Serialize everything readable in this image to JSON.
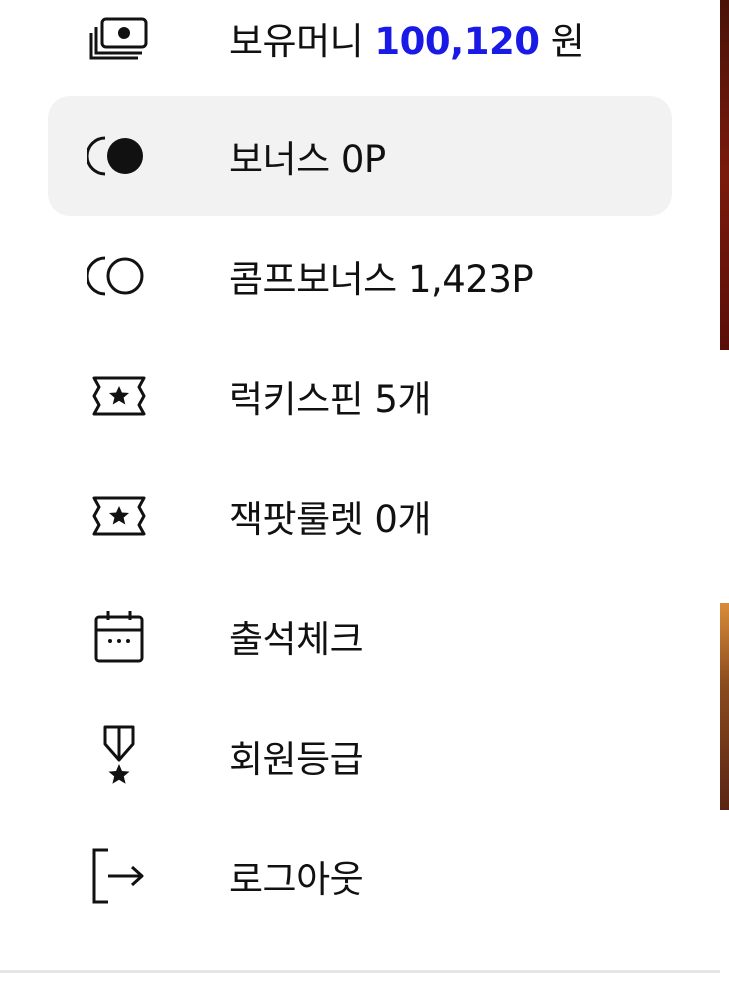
{
  "menu": {
    "items": [
      {
        "icon": "money-icon",
        "label": "보유머니 ",
        "amount": "100,120",
        "suffix": " 원"
      },
      {
        "icon": "bonus-coin-icon",
        "label": "보너스 0P"
      },
      {
        "icon": "comp-bonus-coin-icon",
        "label": "콤프보너스 1,423P"
      },
      {
        "icon": "ticket-star-icon",
        "label": "럭키스핀 5개"
      },
      {
        "icon": "ticket-star-icon",
        "label": "잭팟룰렛 0개"
      },
      {
        "icon": "calendar-icon",
        "label": "출석체크"
      },
      {
        "icon": "medal-icon",
        "label": "회원등급"
      },
      {
        "icon": "logout-icon",
        "label": "로그아웃"
      }
    ]
  },
  "colors": {
    "money_amount": "#1a1ae6",
    "active_background": "#f2f2f3"
  }
}
